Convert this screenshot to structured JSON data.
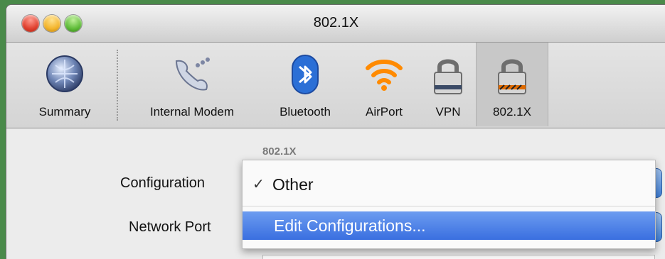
{
  "window": {
    "title": "802.1X"
  },
  "toolbar": {
    "items": [
      {
        "label": "Summary",
        "icon": "globe-icon"
      },
      {
        "label": "Internal Modem",
        "icon": "phone-modem-icon"
      },
      {
        "label": "Bluetooth",
        "icon": "bluetooth-icon"
      },
      {
        "label": "AirPort",
        "icon": "airport-wifi-icon"
      },
      {
        "label": "VPN",
        "icon": "vpn-lock-icon"
      },
      {
        "label": "802.1X",
        "icon": "8021x-lock-icon"
      }
    ],
    "active": "802.1X"
  },
  "content": {
    "section_title": "802.1X",
    "configuration_label": "Configuration",
    "network_port_label": "Network Port"
  },
  "menu": {
    "checked_item": "Other",
    "selected_item": "Edit Configurations..."
  },
  "colors": {
    "menu_highlight": "#3a6fe0",
    "airport_orange": "#ff8a00",
    "bluetooth_blue": "#2b6fd6"
  }
}
